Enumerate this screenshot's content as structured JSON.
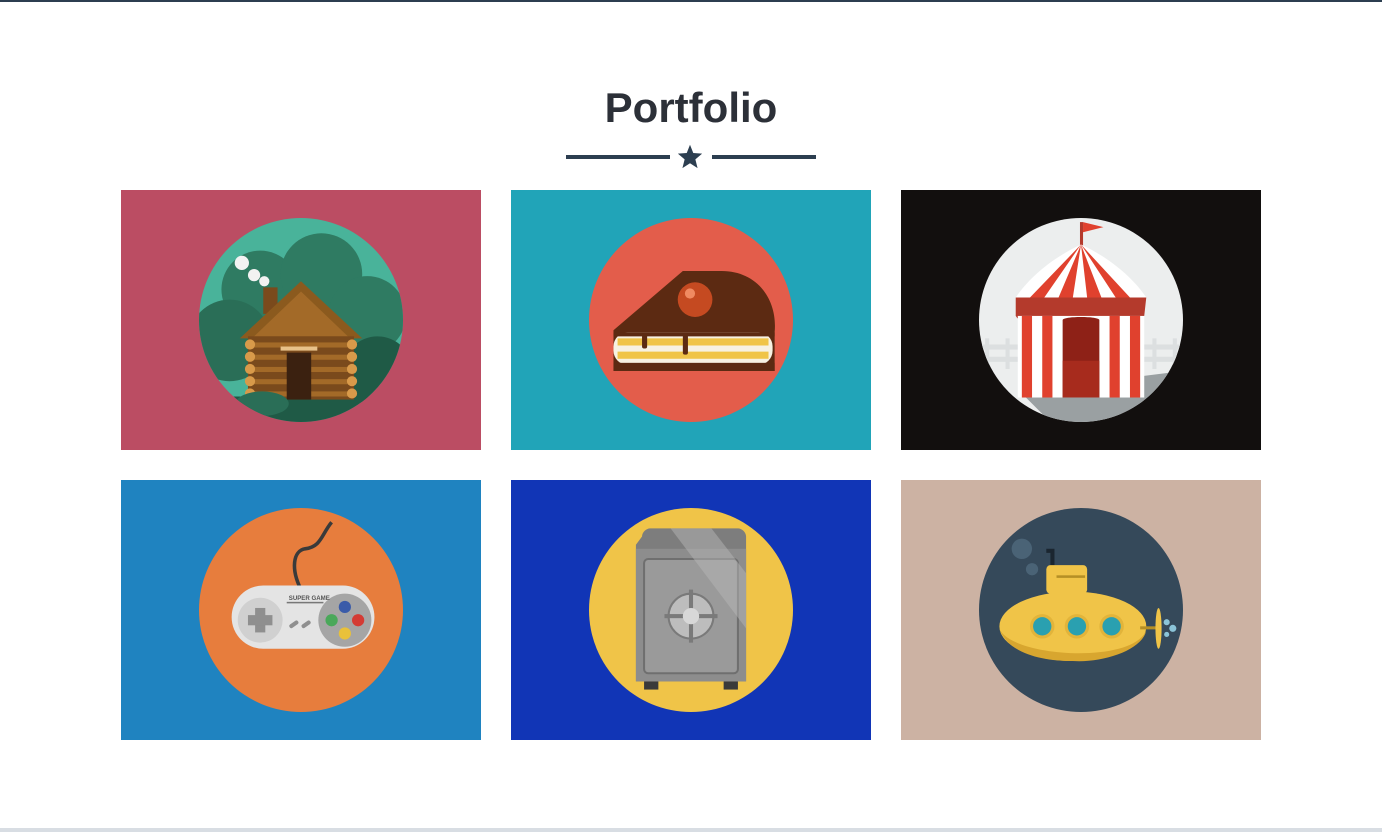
{
  "page": {
    "title": "Portfolio"
  },
  "portfolio": {
    "items": [
      {
        "icon": "log-cabin-icon",
        "bg": "#bb4d63",
        "circle": "#49b39a"
      },
      {
        "icon": "cake-slice-icon",
        "bg": "#21a4b8",
        "circle": "#e35d4b"
      },
      {
        "icon": "circus-tent-icon",
        "bg": "#120f0e",
        "circle": "#eceeee"
      },
      {
        "icon": "game-controller-icon",
        "bg": "#1f83c0",
        "circle": "#e77d3d",
        "controller_text": "SUPER GAME"
      },
      {
        "icon": "safe-icon",
        "bg": "#1135b6",
        "circle": "#f0c448"
      },
      {
        "icon": "submarine-icon",
        "bg": "#ccb2a3",
        "circle": "#35495a"
      }
    ]
  },
  "colors": {
    "accent": "#2c3e50",
    "title_text": "#2c3038"
  }
}
